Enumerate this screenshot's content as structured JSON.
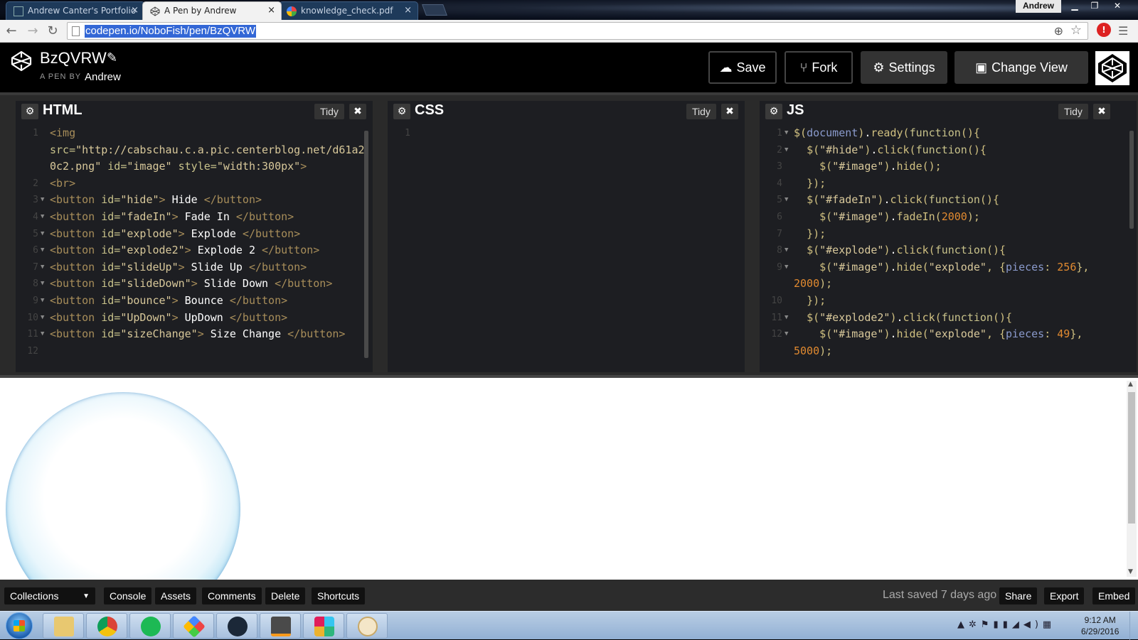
{
  "browser": {
    "tabs": [
      {
        "title": "Andrew Canter's Portfolio",
        "active": false
      },
      {
        "title": "A Pen by Andrew",
        "active": true
      },
      {
        "title": "knowledge_check.pdf",
        "active": false
      }
    ],
    "user_badge": "Andrew",
    "url": "codepen.io/NoboFish/pen/BzQVRW"
  },
  "header": {
    "pen_title": "BzQVRW",
    "by_label": "A PEN BY",
    "author": "Andrew",
    "buttons": {
      "save": "Save",
      "fork": "Fork",
      "settings": "Settings",
      "change_view": "Change View"
    }
  },
  "editors": {
    "html": {
      "title": "HTML",
      "tidy": "Tidy"
    },
    "css": {
      "title": "CSS",
      "tidy": "Tidy"
    },
    "js": {
      "title": "JS",
      "tidy": "Tidy"
    }
  },
  "html_code": [
    {
      "n": "1",
      "fold": false,
      "segs": [
        [
          "tg",
          "<img"
        ]
      ]
    },
    {
      "n": "",
      "fold": false,
      "segs": [
        [
          "at",
          "src="
        ],
        [
          "st2",
          "\"http://cabschau.c.a.pic.centerblog.net/d61a2"
        ]
      ]
    },
    {
      "n": "",
      "fold": false,
      "segs": [
        [
          "st2",
          "0c2.png\""
        ],
        [
          "tx",
          " "
        ],
        [
          "at",
          "id="
        ],
        [
          "st2",
          "\"image\""
        ],
        [
          "tx",
          " "
        ],
        [
          "at",
          "style="
        ],
        [
          "st2",
          "\"width:300px\""
        ],
        [
          "tg",
          ">"
        ]
      ]
    },
    {
      "n": "2",
      "fold": false,
      "segs": [
        [
          "tg",
          "<br>"
        ]
      ]
    },
    {
      "n": "3",
      "fold": true,
      "segs": [
        [
          "tg",
          "<button "
        ],
        [
          "at",
          "id="
        ],
        [
          "st2",
          "\"hide\""
        ],
        [
          "tg",
          ">"
        ],
        [
          "tx",
          " Hide "
        ],
        [
          "tg",
          "</button>"
        ]
      ]
    },
    {
      "n": "4",
      "fold": true,
      "segs": [
        [
          "tg",
          "<button "
        ],
        [
          "at",
          "id="
        ],
        [
          "st2",
          "\"fadeIn\""
        ],
        [
          "tg",
          ">"
        ],
        [
          "tx",
          " Fade In "
        ],
        [
          "tg",
          "</button>"
        ]
      ]
    },
    {
      "n": "5",
      "fold": true,
      "segs": [
        [
          "tg",
          "<button "
        ],
        [
          "at",
          "id="
        ],
        [
          "st2",
          "\"explode\""
        ],
        [
          "tg",
          ">"
        ],
        [
          "tx",
          " Explode "
        ],
        [
          "tg",
          "</button>"
        ]
      ]
    },
    {
      "n": "6",
      "fold": true,
      "segs": [
        [
          "tg",
          "<button "
        ],
        [
          "at",
          "id="
        ],
        [
          "st2",
          "\"explode2\""
        ],
        [
          "tg",
          ">"
        ],
        [
          "tx",
          " Explode 2 "
        ],
        [
          "tg",
          "</button>"
        ]
      ]
    },
    {
      "n": "7",
      "fold": true,
      "segs": [
        [
          "tg",
          "<button "
        ],
        [
          "at",
          "id="
        ],
        [
          "st2",
          "\"slideUp\""
        ],
        [
          "tg",
          ">"
        ],
        [
          "tx",
          " Slide Up "
        ],
        [
          "tg",
          "</button>"
        ]
      ]
    },
    {
      "n": "8",
      "fold": true,
      "segs": [
        [
          "tg",
          "<button "
        ],
        [
          "at",
          "id="
        ],
        [
          "st2",
          "\"slideDown\""
        ],
        [
          "tg",
          ">"
        ],
        [
          "tx",
          " Slide Down "
        ],
        [
          "tg",
          "</button>"
        ]
      ]
    },
    {
      "n": "9",
      "fold": true,
      "segs": [
        [
          "tg",
          "<button "
        ],
        [
          "at",
          "id="
        ],
        [
          "st2",
          "\"bounce\""
        ],
        [
          "tg",
          ">"
        ],
        [
          "tx",
          " Bounce "
        ],
        [
          "tg",
          "</button>"
        ]
      ]
    },
    {
      "n": "10",
      "fold": true,
      "segs": [
        [
          "tg",
          "<button "
        ],
        [
          "at",
          "id="
        ],
        [
          "st2",
          "\"UpDown\""
        ],
        [
          "tg",
          ">"
        ],
        [
          "tx",
          " UpDown "
        ],
        [
          "tg",
          "</button>"
        ]
      ]
    },
    {
      "n": "11",
      "fold": true,
      "segs": [
        [
          "tg",
          "<button "
        ],
        [
          "at",
          "id="
        ],
        [
          "st2",
          "\"sizeChange\""
        ],
        [
          "tg",
          ">"
        ],
        [
          "tx",
          " Size Change "
        ],
        [
          "tg",
          "</button>"
        ]
      ]
    },
    {
      "n": "12",
      "fold": false,
      "segs": []
    }
  ],
  "css_code": [
    {
      "n": "1",
      "fold": false,
      "segs": []
    }
  ],
  "js_code": [
    {
      "n": "1",
      "fold": true,
      "segs": [
        [
          "fn",
          "$("
        ],
        [
          "ob",
          "document"
        ],
        [
          "fn",
          ")"
        ],
        [
          "tx",
          "."
        ],
        [
          "fn",
          "ready("
        ],
        [
          "kw",
          "function"
        ],
        [
          "fn",
          "(){"
        ]
      ]
    },
    {
      "n": "2",
      "fold": true,
      "segs": [
        [
          "tx",
          "  "
        ],
        [
          "fn",
          "$("
        ],
        [
          "st2",
          "\"#hide\""
        ],
        [
          "fn",
          ")"
        ],
        [
          "tx",
          "."
        ],
        [
          "fn",
          "click("
        ],
        [
          "kw",
          "function"
        ],
        [
          "fn",
          "(){"
        ]
      ]
    },
    {
      "n": "3",
      "fold": false,
      "segs": [
        [
          "tx",
          "    "
        ],
        [
          "fn",
          "$("
        ],
        [
          "st2",
          "\"#image\""
        ],
        [
          "fn",
          ")"
        ],
        [
          "tx",
          "."
        ],
        [
          "fn",
          "hide();"
        ]
      ]
    },
    {
      "n": "4",
      "fold": false,
      "segs": [
        [
          "tx",
          "  "
        ],
        [
          "fn",
          "});"
        ]
      ]
    },
    {
      "n": "5",
      "fold": true,
      "segs": [
        [
          "tx",
          "  "
        ],
        [
          "fn",
          "$("
        ],
        [
          "st2",
          "\"#fadeIn\""
        ],
        [
          "fn",
          ")"
        ],
        [
          "tx",
          "."
        ],
        [
          "fn",
          "click("
        ],
        [
          "kw",
          "function"
        ],
        [
          "fn",
          "(){"
        ]
      ]
    },
    {
      "n": "6",
      "fold": false,
      "segs": [
        [
          "tx",
          "    "
        ],
        [
          "fn",
          "$("
        ],
        [
          "st2",
          "\"#image\""
        ],
        [
          "fn",
          ")"
        ],
        [
          "tx",
          "."
        ],
        [
          "fn",
          "fadeIn("
        ],
        [
          "nm",
          "2000"
        ],
        [
          "fn",
          ");"
        ]
      ]
    },
    {
      "n": "7",
      "fold": false,
      "segs": [
        [
          "tx",
          "  "
        ],
        [
          "fn",
          "});"
        ]
      ]
    },
    {
      "n": "8",
      "fold": true,
      "segs": [
        [
          "tx",
          "  "
        ],
        [
          "fn",
          "$("
        ],
        [
          "st2",
          "\"#explode\""
        ],
        [
          "fn",
          ")"
        ],
        [
          "tx",
          "."
        ],
        [
          "fn",
          "click("
        ],
        [
          "kw",
          "function"
        ],
        [
          "fn",
          "(){"
        ]
      ]
    },
    {
      "n": "9",
      "fold": true,
      "segs": [
        [
          "tx",
          "    "
        ],
        [
          "fn",
          "$("
        ],
        [
          "st2",
          "\"#image\""
        ],
        [
          "fn",
          ")"
        ],
        [
          "tx",
          "."
        ],
        [
          "fn",
          "hide("
        ],
        [
          "st2",
          "\"explode\""
        ],
        [
          "fn",
          ", {"
        ],
        [
          "ob",
          "pieces"
        ],
        [
          "fn",
          ": "
        ],
        [
          "nm",
          "256"
        ],
        [
          "fn",
          "},"
        ]
      ]
    },
    {
      "n": "",
      "fold": false,
      "segs": [
        [
          "nm",
          "2000"
        ],
        [
          "fn",
          ");"
        ]
      ]
    },
    {
      "n": "10",
      "fold": false,
      "segs": [
        [
          "tx",
          "  "
        ],
        [
          "fn",
          "});"
        ]
      ]
    },
    {
      "n": "11",
      "fold": true,
      "segs": [
        [
          "tx",
          "  "
        ],
        [
          "fn",
          "$("
        ],
        [
          "st2",
          "\"#explode2\""
        ],
        [
          "fn",
          ")"
        ],
        [
          "tx",
          "."
        ],
        [
          "fn",
          "click("
        ],
        [
          "kw",
          "function"
        ],
        [
          "fn",
          "(){"
        ]
      ]
    },
    {
      "n": "12",
      "fold": true,
      "segs": [
        [
          "tx",
          "    "
        ],
        [
          "fn",
          "$("
        ],
        [
          "st2",
          "\"#image\""
        ],
        [
          "fn",
          ")"
        ],
        [
          "tx",
          "."
        ],
        [
          "fn",
          "hide("
        ],
        [
          "st2",
          "\"explode\""
        ],
        [
          "fn",
          ", {"
        ],
        [
          "ob",
          "pieces"
        ],
        [
          "fn",
          ": "
        ],
        [
          "nm",
          "49"
        ],
        [
          "fn",
          "},"
        ]
      ]
    },
    {
      "n": "",
      "fold": false,
      "segs": [
        [
          "nm",
          "5000"
        ],
        [
          "fn",
          ");"
        ]
      ]
    }
  ],
  "footer": {
    "collections": "Collections",
    "console": "Console",
    "assets": "Assets",
    "comments": "Comments",
    "delete": "Delete",
    "shortcuts": "Shortcuts",
    "last_saved": "Last saved 7 days ago",
    "share": "Share",
    "export": "Export",
    "embed": "Embed"
  },
  "taskbar": {
    "apps": [
      "file-explorer-icon",
      "chrome-icon",
      "spotify-icon",
      "palette-app-icon",
      "steam-icon",
      "sublime-text-icon",
      "slack-icon",
      "paint-icon"
    ],
    "time": "9:12 AM",
    "date": "6/29/2016"
  },
  "colors": {
    "editor_bg": "#1d1e22",
    "header_bg": "#000000",
    "url_highlight": "#3367d6",
    "string": "#d8c89a",
    "number": "#e18a30"
  }
}
